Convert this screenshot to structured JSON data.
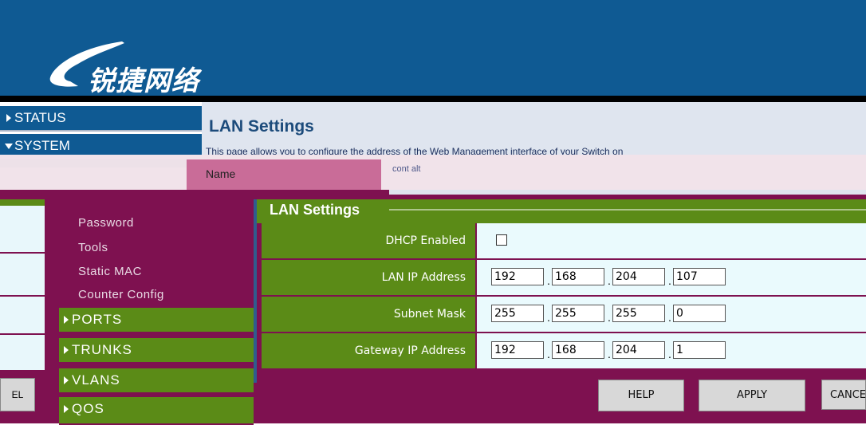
{
  "header": {
    "logo_text": "锐捷网络"
  },
  "nav": {
    "status": "STATUS",
    "system": "SYSTEM",
    "system_sub": [
      "Password",
      "Tools",
      "Static MAC",
      "Counter Config"
    ],
    "ports": "PORTS",
    "trunks": "TRUNKS",
    "vlans": "VLANS",
    "qos": "QOS"
  },
  "main": {
    "title": "LAN Settings",
    "description": "This page allows you to configure the address of the Web Management interface of your Switch on",
    "description_tail": "cont alt",
    "name_label": "Name",
    "fieldset_legend": "LAN Settings",
    "rows": [
      {
        "label": "DHCP Enabled",
        "checked": false
      },
      {
        "label": "LAN IP Address",
        "octets": [
          "192",
          "168",
          "204",
          "107"
        ]
      },
      {
        "label": "Subnet Mask",
        "octets": [
          "255",
          "255",
          "255",
          "0"
        ]
      },
      {
        "label": "Gateway IP Address",
        "octets": [
          "192",
          "168",
          "204",
          "1"
        ]
      }
    ]
  },
  "buttons": {
    "left_partial": "EL",
    "help": "HELP",
    "apply": "APPLY",
    "cancel": "CANCE"
  }
}
